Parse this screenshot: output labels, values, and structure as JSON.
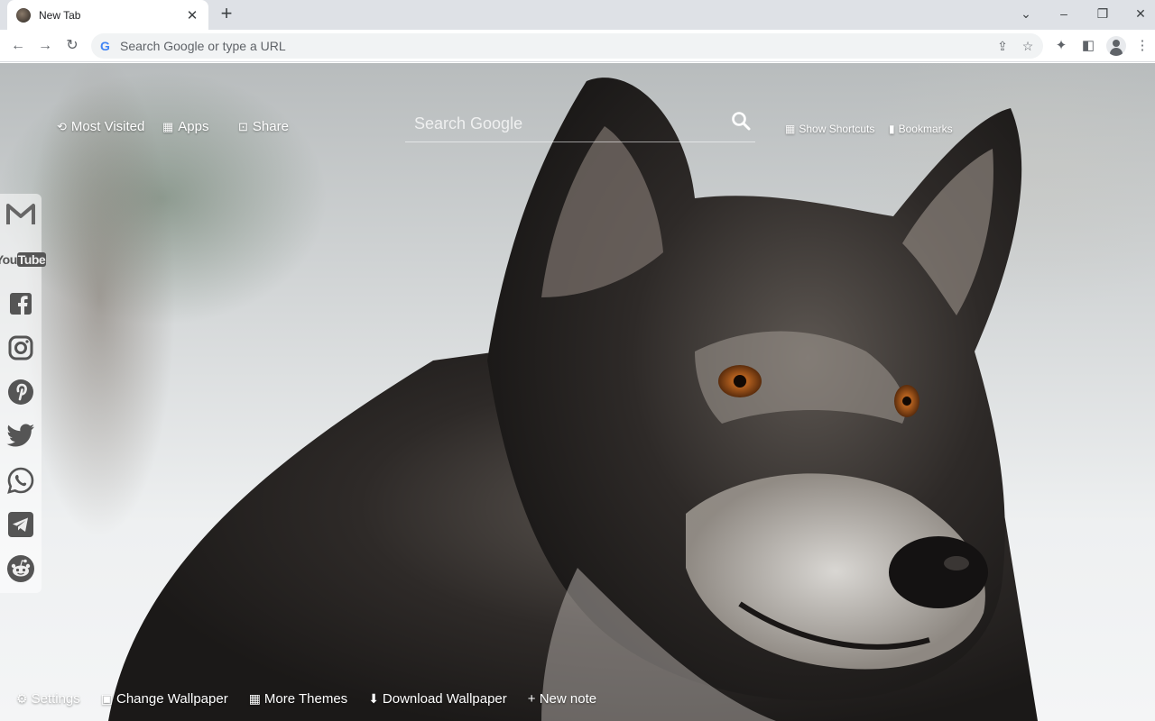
{
  "tab": {
    "title": "New Tab"
  },
  "omnibox": {
    "placeholder": "Search Google or type a URL"
  },
  "top_links": {
    "most_visited": "Most Visited",
    "apps": "Apps",
    "share": "Share",
    "show_shortcuts": "Show Shortcuts",
    "bookmarks": "Bookmarks"
  },
  "search": {
    "placeholder": "Search Google"
  },
  "social": {
    "youtube_you": "You",
    "youtube_tube": "Tube",
    "items": [
      "gmail-icon",
      "youtube-icon",
      "facebook-icon",
      "instagram-icon",
      "pinterest-icon",
      "twitter-icon",
      "whatsapp-icon",
      "telegram-icon",
      "reddit-icon"
    ]
  },
  "bottom_bar": {
    "settings": "Settings",
    "change_wallpaper": "Change Wallpaper",
    "more_themes": "More Themes",
    "download_wallpaper": "Download Wallpaper",
    "new_note": "+ New note"
  },
  "colors": {
    "toolbar_bg": "#ffffff",
    "tabstrip_bg": "#dee1e6",
    "omnibox_bg": "#f1f3f4"
  }
}
